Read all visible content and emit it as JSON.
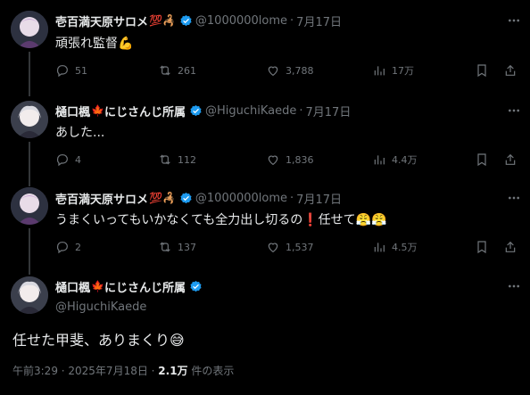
{
  "tweets": [
    {
      "name": "壱百満天原サロメ",
      "name_emojis": "💯🦂",
      "handle": "@1000000lome",
      "date": "7月17日",
      "text": "頑張れ監督",
      "text_emoji": "💪",
      "replies": "51",
      "reposts": "261",
      "likes": "3,788",
      "views": "17万"
    },
    {
      "name": "樋口楓",
      "name_emoji": "🍁",
      "name_suffix": "にじさんじ所属",
      "handle": "@HiguchiKaede",
      "date": "7月17日",
      "text": "あした...",
      "replies": "4",
      "reposts": "112",
      "likes": "1,836",
      "views": "4.4万"
    },
    {
      "name": "壱百満天原サロメ",
      "name_emojis": "💯🦂",
      "handle": "@1000000lome",
      "date": "7月17日",
      "text": "うまくいってもいかなくても全力出し切るの",
      "text_emoji_1": "❗",
      "text_mid": "任せて",
      "text_emoji_2": "😤😤",
      "replies": "2",
      "reposts": "137",
      "likes": "1,537",
      "views": "4.5万"
    }
  ],
  "main_tweet": {
    "name": "樋口楓",
    "name_emoji": "🍁",
    "name_suffix": "にじさんじ所属",
    "handle": "@HiguchiKaede",
    "text": "任せた甲斐、ありまくり",
    "text_emoji": "😅",
    "timestamp": "午前3:29 · 2025年7月18日 · ",
    "views_count": "2.1万",
    "views_label": " 件の表示"
  },
  "colors": {
    "verified": "#1d9bf0",
    "muted": "#71767b",
    "text": "#e7e9ea",
    "background": "#000000"
  }
}
